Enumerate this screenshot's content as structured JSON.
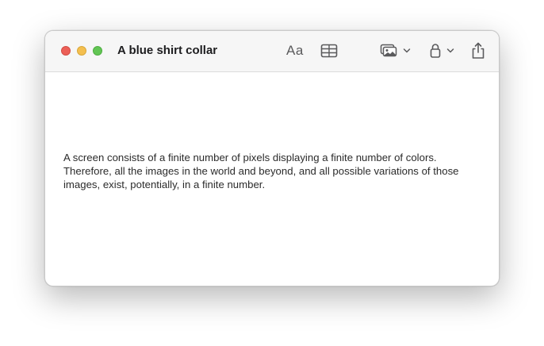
{
  "window": {
    "title": "A blue shirt collar"
  },
  "toolbar": {
    "format_label": "Aa",
    "icons": [
      "format-icon",
      "table-icon",
      "media-icon",
      "chevron-down-icon",
      "lock-icon",
      "chevron-down-icon",
      "share-icon"
    ]
  },
  "note": {
    "body": "A screen consists of a finite number of pixels displaying a finite number of colors. Therefore, all the images in the world and beyond, and all possible variations of those images, exist, potentially, in a finite number."
  },
  "colors": {
    "close": "#ec5f57",
    "minimize": "#f4bf4f",
    "zoom": "#62c554",
    "icon": "#5a5a5c",
    "text": "#2b2b2b"
  }
}
